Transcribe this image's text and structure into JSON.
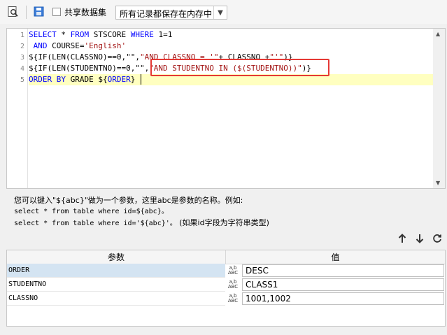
{
  "toolbar": {
    "shared_dataset_label": "共享数据集",
    "shared_dataset_checked": false,
    "storage_mode": "所有记录都保存在内存中"
  },
  "editor": {
    "line_numbers": [
      "1",
      "2",
      "3",
      "4",
      "5"
    ],
    "lines": [
      [
        {
          "t": "SELECT",
          "c": "kw"
        },
        {
          "t": " * ",
          "c": "plain"
        },
        {
          "t": "FROM",
          "c": "kw"
        },
        {
          "t": " STSCORE ",
          "c": "plain"
        },
        {
          "t": "WHERE",
          "c": "kw"
        },
        {
          "t": " 1=1",
          "c": "plain"
        }
      ],
      [
        {
          "t": " AND",
          "c": "kw"
        },
        {
          "t": " COURSE=",
          "c": "plain"
        },
        {
          "t": "'English'",
          "c": "str"
        }
      ],
      [
        {
          "t": "${IF(LEN(CLASSNO)==0,\"\",",
          "c": "plain"
        },
        {
          "t": "\"AND CLASSNO = '\"",
          "c": "str"
        },
        {
          "t": "+ CLASSNO +",
          "c": "plain"
        },
        {
          "t": "\"'\"",
          "c": "str"
        },
        {
          "t": ")}",
          "c": "plain"
        }
      ],
      [
        {
          "t": "${IF(LEN(STUDENTNO)==0,\"\",",
          "c": "plain"
        },
        {
          "t": "\"AND STUDENTNO IN ($(STUDENTNO))\"",
          "c": "str"
        },
        {
          "t": ")}",
          "c": "plain"
        }
      ],
      [
        {
          "t": "ORDER BY",
          "c": "kw"
        },
        {
          "t": " GRADE ${",
          "c": "plain"
        },
        {
          "t": "ORDER",
          "c": "kw"
        },
        {
          "t": "}",
          "c": "plain"
        }
      ]
    ]
  },
  "help": {
    "line1": "您可以键入\"${abc}\"做为一个参数，这里abc是参数的名称。例如:",
    "line2": "select * from table where id=${abc}。",
    "line3a": "select * from table where id='${abc}'。",
    "line3b": "(如果id字段为字符串类型)"
  },
  "params": {
    "col_name": "参数",
    "col_value": "值",
    "rows": [
      {
        "name": "ORDER",
        "value": "DESC"
      },
      {
        "name": "STUDENTNO",
        "value": "CLASS1"
      },
      {
        "name": "CLASSNO",
        "value": "1001,1002"
      }
    ]
  },
  "icons": {
    "row_type_icon_top": "a,b",
    "row_type_icon_bottom": "ABC"
  },
  "colors": {
    "keyword": "#0000ff",
    "string": "#a31515",
    "highlight_line": "#ffffc0",
    "annotation_box": "#e53935"
  }
}
